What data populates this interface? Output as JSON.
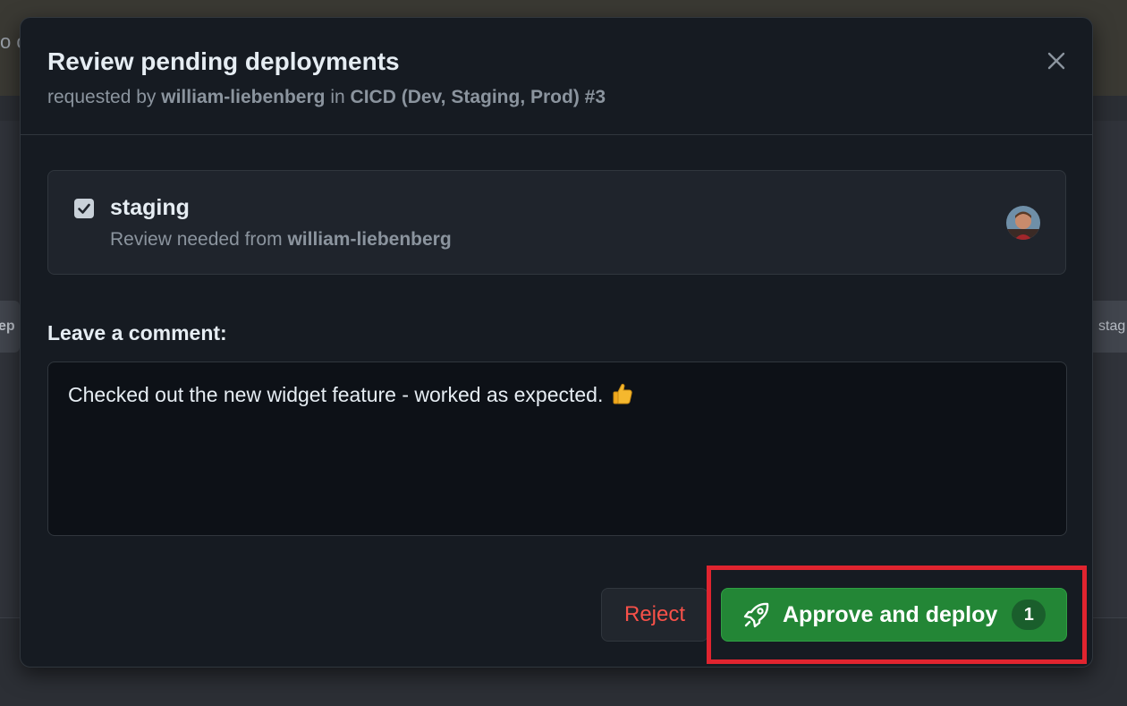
{
  "background": {
    "left_text": "o c",
    "left_pill": "ep",
    "right_pill": "stag"
  },
  "dialog": {
    "title": "Review pending deployments",
    "subtitle": {
      "prefix": "requested by",
      "user": "william-liebenberg",
      "middle": "in",
      "workflow": "CICD (Dev, Staging, Prod) #3"
    },
    "close_icon": "close-icon"
  },
  "environment": {
    "checked": true,
    "name": "staging",
    "review_prefix": "Review needed from",
    "reviewer": "william-liebenberg"
  },
  "comment": {
    "label": "Leave a comment:",
    "value": "Checked out the new widget feature - worked as expected.",
    "emoji_icon": "thumbs-up-icon"
  },
  "actions": {
    "reject_label": "Reject",
    "approve_label": "Approve and deploy",
    "approve_count": "1",
    "approve_icon": "rocket-icon"
  },
  "colors": {
    "dialog_bg": "#161b22",
    "approve_green": "#238636",
    "reject_red": "#f85149",
    "highlight_red": "#e0242f"
  }
}
